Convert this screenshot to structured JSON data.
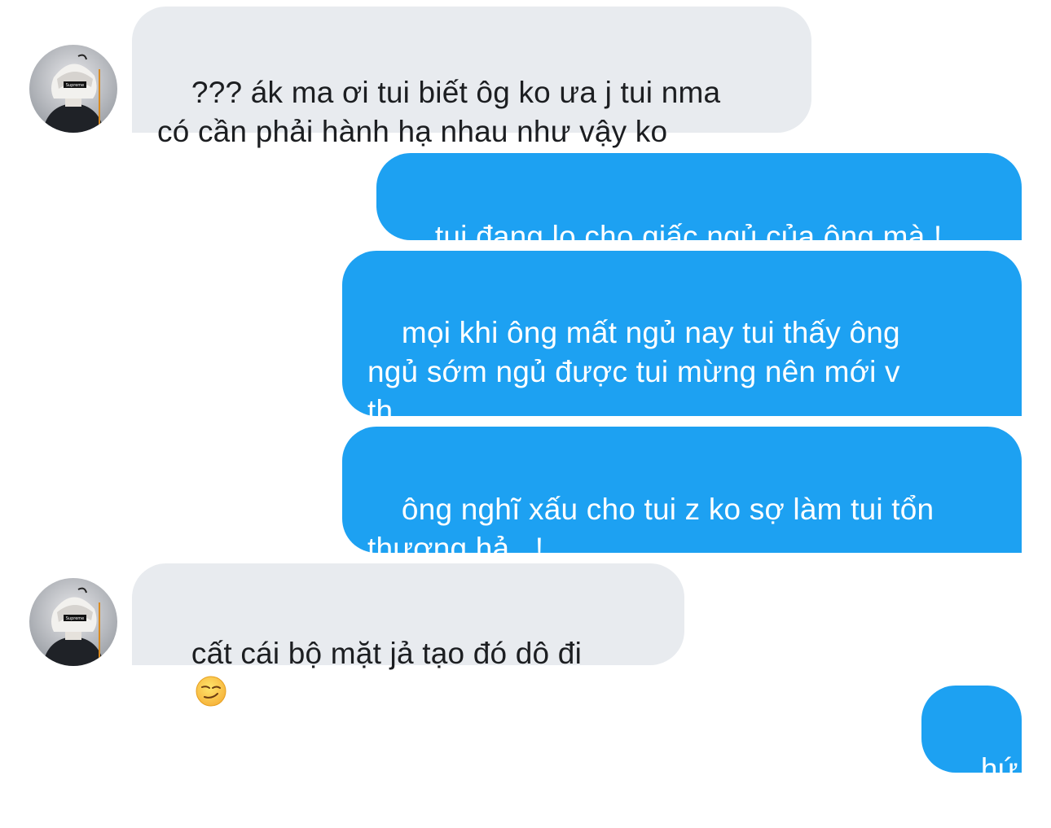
{
  "messages": [
    {
      "side": "incoming",
      "text": "??? ák ma ơi tui biết ôg ko ưa j tui nma\ncó cần phải hành hạ nhau như vậy ko"
    },
    {
      "side": "outgoing",
      "text": "tui đang lo cho giấc ngủ của ông mà !"
    },
    {
      "side": "outgoing",
      "text": "mọi khi ông mất ngủ nay tui thấy ông\nngủ sớm ngủ được tui mừng nên mới v\nth"
    },
    {
      "side": "outgoing",
      "text": "ông nghĩ xấu cho tui z ko sợ làm tui tổn\nthương hả...!"
    },
    {
      "side": "incoming",
      "text": "cất cái bộ mặt jả tạo đó dô đi",
      "emoji": "smirking-face-emoji"
    },
    {
      "side": "outgoing",
      "text": "hứ"
    }
  ],
  "colors": {
    "incoming_bubble": "#e8ebef",
    "outgoing_bubble": "#1da1f2",
    "incoming_text": "#1c1e21",
    "outgoing_text": "#ffffff"
  },
  "avatar_label": "Supreme"
}
